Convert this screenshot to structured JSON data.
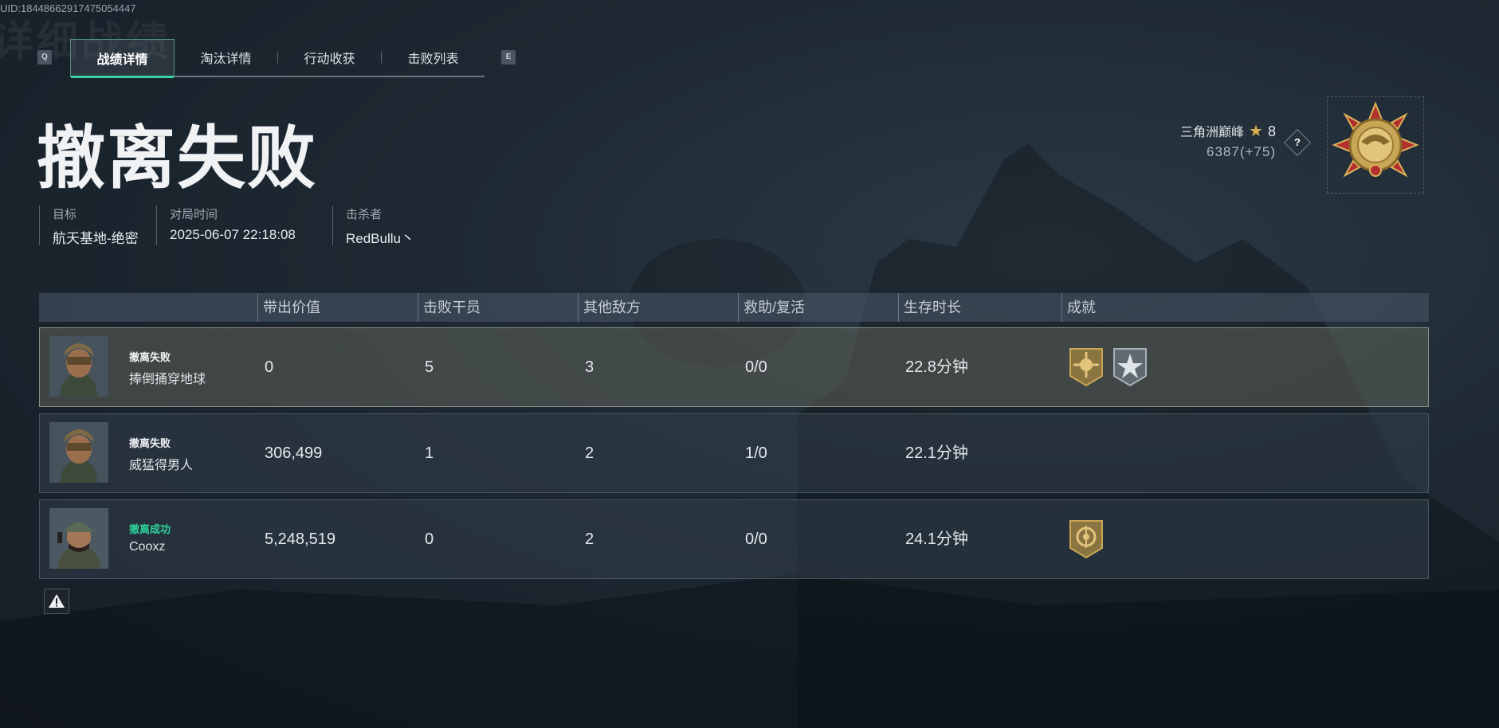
{
  "uid_text": "UID:18448662917475054447",
  "background_title": "详细战绩",
  "key_hints": {
    "left": "Q",
    "right": "E"
  },
  "tabs": [
    {
      "label": "战绩详情",
      "active": true
    },
    {
      "label": "淘汰详情",
      "active": false
    },
    {
      "label": "行动收获",
      "active": false
    },
    {
      "label": "击败列表",
      "active": false
    }
  ],
  "result_title": "撤离失败",
  "info": {
    "target_label": "目标",
    "target_value": "航天基地-绝密",
    "time_label": "对局时间",
    "time_value": "2025-06-07 22:18:08",
    "killer_label": "击杀者",
    "killer_value": "RedBullu丶"
  },
  "rank": {
    "name": "三角洲巅峰",
    "level": "8",
    "score": "6387(+75)",
    "help_label": "?",
    "medal_icon": "rank-medal-icon"
  },
  "table": {
    "headers": [
      "带出价值",
      "击败干员",
      "其他敌方",
      "救助/复活",
      "生存时长",
      "成就"
    ],
    "rows": [
      {
        "status": "撤离失败",
        "name": "捧倒捅穿地球",
        "value": "0",
        "kills": "5",
        "other": "3",
        "assist": "0/0",
        "time": "22.8分钟",
        "success": false,
        "highlight": true,
        "badges": [
          "gold-sun-badge-icon",
          "silver-star-badge-icon"
        ]
      },
      {
        "status": "撤离失败",
        "name": "威猛得男人",
        "value": "306,499",
        "kills": "1",
        "other": "2",
        "assist": "1/0",
        "time": "22.1分钟",
        "success": false,
        "highlight": false,
        "badges": []
      },
      {
        "status": "撤离成功",
        "name": "Cooxz",
        "value": "5,248,519",
        "kills": "0",
        "other": "2",
        "assist": "0/0",
        "time": "24.1分钟",
        "success": true,
        "highlight": false,
        "badges": [
          "gold-target-badge-icon"
        ]
      }
    ]
  },
  "colors": {
    "accent": "#35d4a0",
    "success": "#2fd29c",
    "gold": "#c9a656"
  }
}
